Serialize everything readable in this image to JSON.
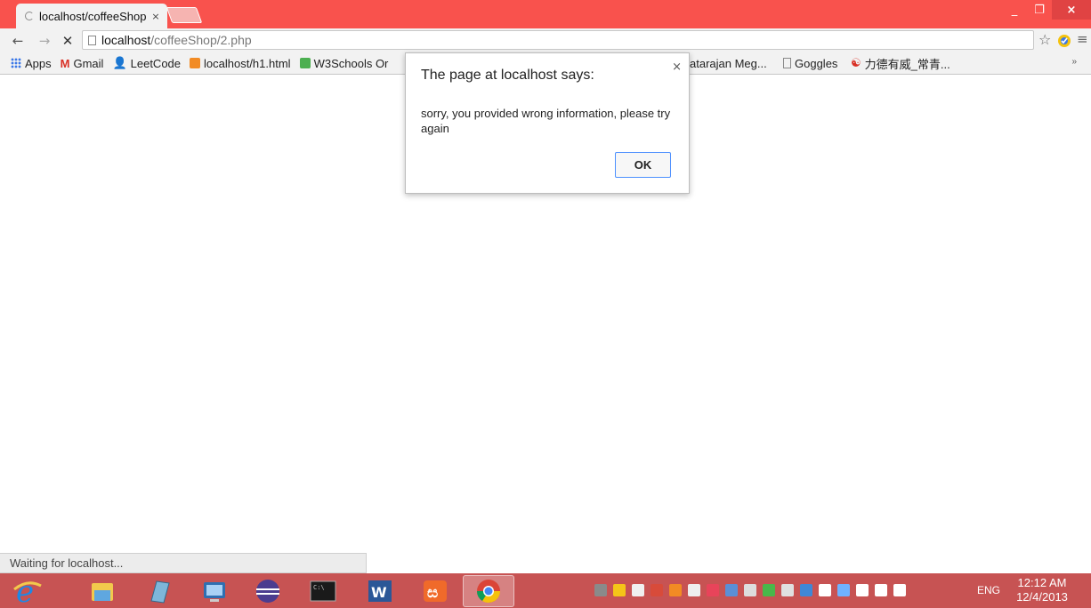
{
  "browser": {
    "tab": {
      "title": "localhost/coffeeShop",
      "close_glyph": "×"
    },
    "window_controls": {
      "minimize": "_",
      "maximize": "❐",
      "close": "×"
    },
    "toolbar": {
      "back_glyph": "←",
      "forward_glyph": "→",
      "stop_glyph": "✕",
      "url_host": "localhost",
      "url_path": "/coffeeShop/2.php",
      "star_glyph": "☆",
      "menu_glyph": "≡"
    },
    "bookmarks": [
      {
        "label": "Apps",
        "icon": "apps-grid-icon",
        "color": "#3b78e7"
      },
      {
        "label": "Gmail",
        "icon": "gmail-icon",
        "color": "#d93025"
      },
      {
        "label": "LeetCode",
        "icon": "person-icon",
        "color": "#333333"
      },
      {
        "label": "localhost/h1.html",
        "icon": "xampp-icon",
        "color": "#f28b24"
      },
      {
        "label": "W3Schools Or",
        "icon": "w3schools-icon",
        "color": "#4caf50"
      },
      {
        "label": "atarajan Meg...",
        "icon": "",
        "color": ""
      },
      {
        "label": "Goggles",
        "icon": "page-icon",
        "color": "#888888"
      },
      {
        "label": "力德有威_常青...",
        "icon": "site-icon",
        "color": "#d93025"
      }
    ],
    "bookmarks_more": "»",
    "status": "Waiting for localhost..."
  },
  "dialog": {
    "title": "The page at localhost says:",
    "message": "sorry, you provided wrong information, please try again",
    "ok_label": "OK",
    "close_glyph": "×"
  },
  "taskbar": {
    "apps": [
      {
        "name": "internet-explorer-icon",
        "color": "#1e88e5"
      },
      {
        "name": "file-explorer-icon",
        "color": "#f2c94c"
      },
      {
        "name": "notes-icon",
        "color": "#7eb6d9"
      },
      {
        "name": "remote-desktop-icon",
        "color": "#2f6fb1"
      },
      {
        "name": "eclipse-icon",
        "color": "#4b3c8f"
      },
      {
        "name": "command-prompt-icon",
        "color": "#1a1a1a"
      },
      {
        "name": "word-icon",
        "color": "#2b5797"
      },
      {
        "name": "xampp-icon",
        "color": "#f06a2a"
      },
      {
        "name": "chrome-icon",
        "color": "#34a853"
      }
    ],
    "tray_icons": [
      {
        "name": "tray-app-icon",
        "color": "#8a8a8a"
      },
      {
        "name": "shield-icon",
        "color": "#f5c518"
      },
      {
        "name": "usb-icon",
        "color": "#f0f0f0"
      },
      {
        "name": "pdf-icon",
        "color": "#d84b3a"
      },
      {
        "name": "xampp-tray-icon",
        "color": "#f28b24"
      },
      {
        "name": "printer-icon",
        "color": "#eeeeee"
      },
      {
        "name": "antivirus-icon",
        "color": "#e8445a"
      },
      {
        "name": "network-monitor-icon",
        "color": "#5b8fd6"
      },
      {
        "name": "clock-tray-icon",
        "color": "#dddddd"
      },
      {
        "name": "sync-icon",
        "color": "#49b84a"
      },
      {
        "name": "window-icon",
        "color": "#e0e0e0"
      },
      {
        "name": "remote-tray-icon",
        "color": "#3f87d6"
      },
      {
        "name": "signal-icon",
        "color": "#ffffff"
      },
      {
        "name": "network-icon",
        "color": "#6fb2ff"
      },
      {
        "name": "flag-icon",
        "color": "#ffffff"
      },
      {
        "name": "battery-icon",
        "color": "#ffffff"
      },
      {
        "name": "volume-icon",
        "color": "#ffffff"
      }
    ],
    "language": "ENG",
    "time": "12:12 AM",
    "date": "12/4/2013"
  }
}
